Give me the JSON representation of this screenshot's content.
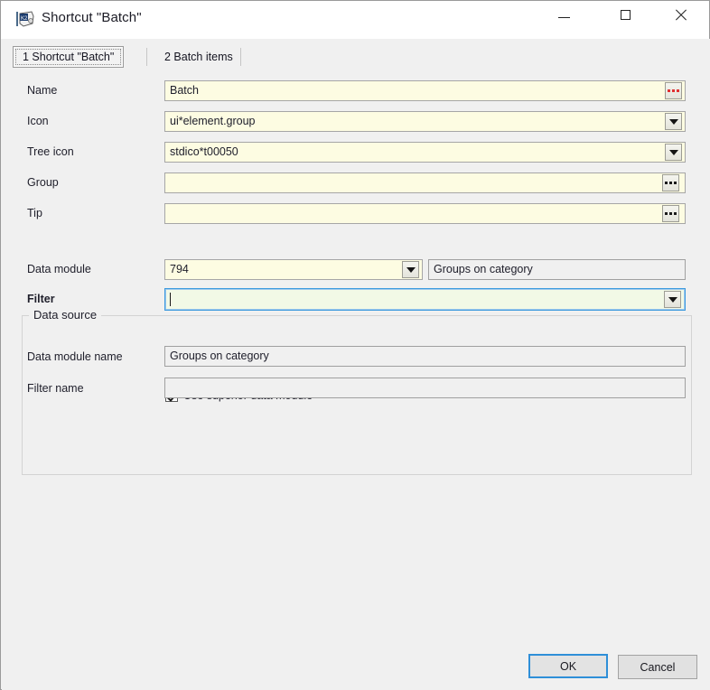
{
  "window": {
    "title": "Shortcut \"Batch\"",
    "app_icon": "app-icon",
    "controls": {
      "minimize": "minimize-icon",
      "maximize": "maximize-icon",
      "close": "close-icon"
    }
  },
  "tabs": [
    {
      "label": "1 Shortcut \"Batch\"",
      "active": true
    },
    {
      "label": "2 Batch items",
      "active": false
    }
  ],
  "form": {
    "rows": [
      {
        "label": "Name",
        "value": "Batch",
        "button": "ellipsis-red"
      },
      {
        "label": "Icon",
        "value": "ui*element.group",
        "button": "dropdown"
      },
      {
        "label": "Tree icon",
        "value": "stdico*t00050",
        "button": "dropdown"
      },
      {
        "label": "Group",
        "value": "",
        "button": "ellipsis"
      },
      {
        "label": "Tip",
        "value": "",
        "button": "ellipsis"
      }
    ]
  },
  "data_source": {
    "title": "Data source",
    "data_module": {
      "label": "Data module",
      "value": "794",
      "button": "dropdown",
      "side_value": "Groups on category"
    },
    "filter": {
      "label": "Filter",
      "value": "",
      "button": "dropdown"
    },
    "use_superior": {
      "label": "Use superior data module",
      "checked": true
    },
    "data_module_name": {
      "label": "Data module name",
      "value": "Groups on category"
    },
    "filter_name": {
      "label": "Filter name",
      "value": ""
    }
  },
  "footer": {
    "ok_label": "OK",
    "cancel_label": "Cancel"
  },
  "colors": {
    "field_editable": "#fdfce2",
    "field_focused": "#f2f9e6",
    "field_readonly": "#f0f0f0",
    "focus_border": "#3c9ade",
    "panel": "#f0f0f0",
    "accent_red_dots": "#e03030"
  }
}
